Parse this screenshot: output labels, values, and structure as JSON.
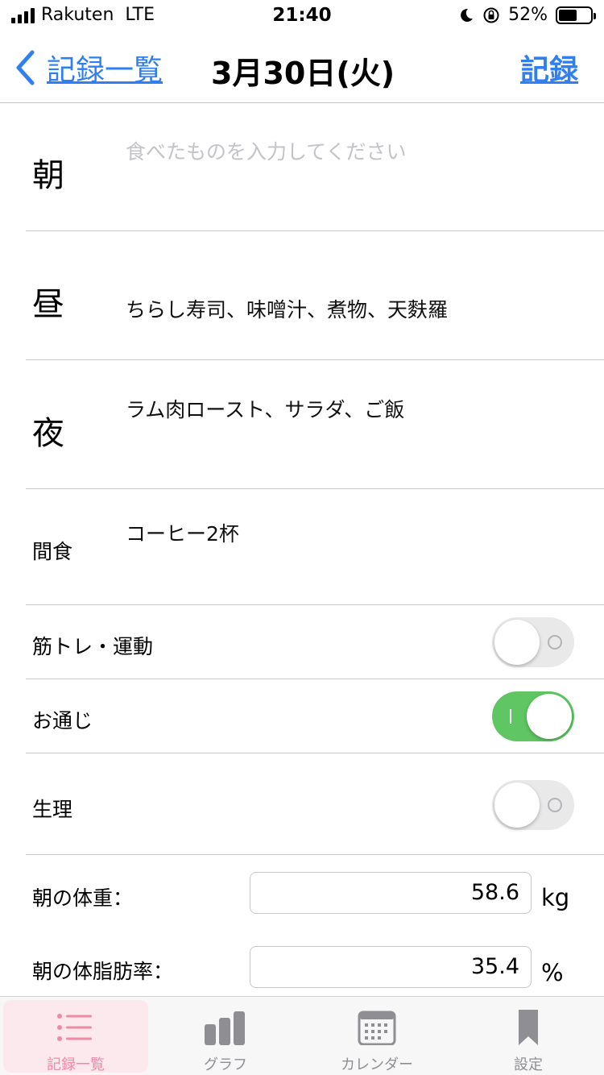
{
  "status_bar": {
    "carrier": "Rakuten",
    "network": "LTE",
    "time": "21:40",
    "battery": "52%",
    "battery_level": 0.52
  },
  "navbar": {
    "back_label": "記録一覧",
    "title": "3月30日(火)",
    "save_label": "記録"
  },
  "meals": [
    {
      "label": "朝",
      "value": "",
      "placeholder": "食べたものを入力してください"
    },
    {
      "label": "昼",
      "value": "ちらし寿司、味噌汁、煮物、天麩羅"
    },
    {
      "label": "夜",
      "value": "ラム肉ロースト、サラダ、ご飯"
    },
    {
      "label": "間食",
      "value": "コーヒー2杯"
    }
  ],
  "toggles": [
    {
      "label": "筋トレ・運動",
      "on": false
    },
    {
      "label": "お通じ",
      "on": true
    },
    {
      "label": "生理",
      "on": false
    }
  ],
  "measurements": [
    {
      "label": "朝の体重：",
      "value": "58.6",
      "unit": "kg"
    },
    {
      "label": "朝の体脂肪率：",
      "value": "35.4",
      "unit": "%"
    }
  ],
  "tabs": [
    {
      "label": "記録一覧",
      "icon": "list-icon",
      "active": true
    },
    {
      "label": "グラフ",
      "icon": "bar-chart-icon",
      "active": false
    },
    {
      "label": "カレンダー",
      "icon": "calendar-icon",
      "active": false
    },
    {
      "label": "設定",
      "icon": "bookmark-icon",
      "active": false
    }
  ],
  "colors": {
    "accent": "#2f7ff3",
    "switch_on": "#5fc663",
    "tab_active": "#ef8aa5"
  }
}
